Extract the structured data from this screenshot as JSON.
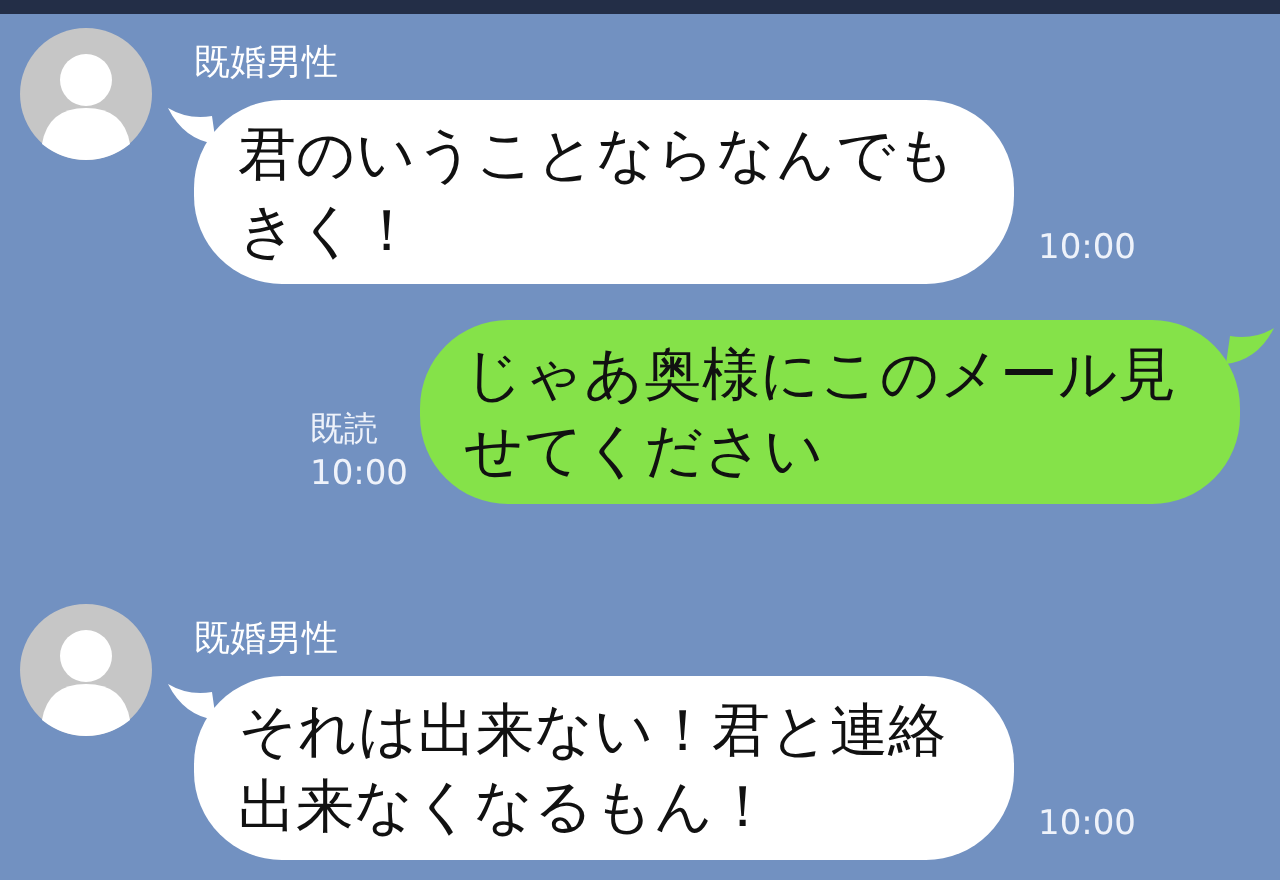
{
  "messages": [
    {
      "kind": "incoming",
      "sender": "既婚男性",
      "text": "君のいうことならなんでもきく！",
      "time": "10:00"
    },
    {
      "kind": "outgoing",
      "read_label": "既読",
      "text": "じゃあ奥様にこのメール見せてください",
      "time": "10:00"
    },
    {
      "kind": "incoming",
      "sender": "既婚男性",
      "text": "それは出来ない！君と連絡出来なくなるもん！",
      "time": "10:00"
    }
  ]
}
